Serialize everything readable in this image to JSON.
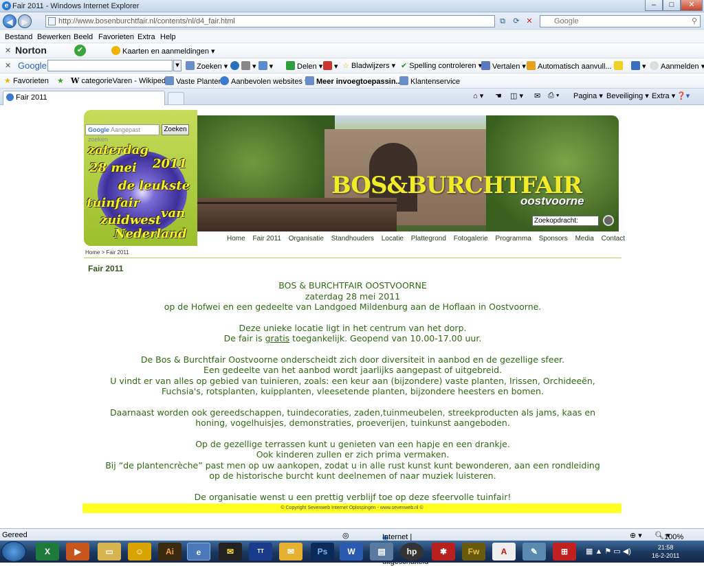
{
  "window": {
    "title": "Fair 2011 - Windows Internet Explorer",
    "minimize": "–",
    "maximize": "□",
    "close": "✕"
  },
  "address": {
    "url": "http://www.bosenburchtfair.nl/contents/nl/d4_fair.html",
    "search_placeholder": "Google",
    "back": "◀",
    "forward": "▶"
  },
  "menu": [
    "Bestand",
    "Bewerken",
    "Beeld",
    "Favorieten",
    "Extra",
    "Help"
  ],
  "norton": {
    "brand": "Norton",
    "status": "✔",
    "cards": "Kaarten en aanmeldingen"
  },
  "googlebar": {
    "brand": "Google",
    "search": "Zoeken",
    "share": "Delen",
    "bookmarks": "Bladwijzers",
    "spell": "Spelling controleren",
    "translate": "Vertalen",
    "autofill": "Automatisch aanvull...",
    "signin": "Aanmelden"
  },
  "favorites": {
    "label": "Favorieten",
    "items": [
      "categorieVaren - Wikipedia",
      "Vaste Planten",
      "Aanbevolen websites",
      "Meer invoegtoepassin...",
      "Klantenservice"
    ]
  },
  "tab": {
    "label": "Fair 2011",
    "tools": [
      "Pagina",
      "Beveiliging",
      "Extra"
    ]
  },
  "site": {
    "search_placeholder": "Aangepast zoeken",
    "search_button": "Zoeken",
    "slogan": [
      "zaterdag",
      "2011",
      "28 mei",
      "de leukste",
      "tuinfair",
      "van",
      "zuidwest",
      "Nederland"
    ],
    "brand": "BOS&BURCHTFAIR",
    "brand_sub": "oostvoorne",
    "zoek_value": "Zoekopdracht:",
    "nav": [
      "Home",
      "Fair 2011",
      "Organisatie",
      "Standhouders",
      "Locatie",
      "Plattegrond",
      "Fotogalerie",
      "Programma",
      "Sponsors",
      "Media",
      "Contact"
    ],
    "breadcrumb": "Home  >  Fair 2011",
    "page_title": "Fair 2011",
    "paragraphs": [
      [
        "BOS & BURCHTFAIR OOSTVOORNE",
        "zaterdag 28 mei 2011",
        "op de Hofwei en een gedeelte van Landgoed Mildenburg aan de Hoflaan in Oostvoorne."
      ],
      [
        "Deze unieke locatie ligt in het centrum van het dorp."
      ],
      [
        "De Bos & Burchtfair Oostvoorne onderscheidt zich door diversiteit in aanbod en de gezellige sfeer.",
        "Een gedeelte van het aanbod wordt jaarlijks aangepast of uitgebreid.",
        "U vindt er van alles op gebied van tuinieren, zoals: een keur aan (bijzondere) vaste planten, Irissen, Orchideeën,",
        "Fuchsia's, rotsplanten, kuipplanten, vleesetende planten, bijzondere heesters en bomen."
      ],
      [
        "Daarnaast worden ook gereedschappen, tuindecoraties, zaden,tuinmeubelen, streekproducten als jams, kaas en",
        "honing, vogelhuisjes, demonstraties, proeverijen, tuinkunst aangeboden."
      ],
      [
        "Op de gezellige terrassen kunt u genieten van een hapje en een drankje.",
        "Ook kinderen zullen er zich prima vermaken.",
        "Bij “de plantencrèche” past men op uw aankopen, zodat u in alle rust kunst kunt bewonderen, aan een rondleiding",
        "op de historische burcht kunt deelnemen of naar muziek luisteren."
      ],
      [
        "De organisatie wenst u een prettig verblijf toe op deze sfeervolle tuinfair!"
      ]
    ],
    "fair_pre": "De fair is ",
    "fair_link": "gratis",
    "fair_post": " toegankelijk. Geopend van 10.00-17.00 uur.",
    "footer": "©  Copyright Sevenweb Internet Oplossingen  -  www.sevenweb.nl  ©"
  },
  "status": {
    "left": "Gereed",
    "zone": "Internet | Beveiligde modus: uitgeschakeld",
    "zoom": "100%"
  },
  "taskbar": {
    "time": "21:58",
    "date": "16-2-2011"
  },
  "colors": {
    "site_green": "#2f6a14",
    "footer_yellow": "#ffff22",
    "banner_text": "#f1ec26"
  }
}
